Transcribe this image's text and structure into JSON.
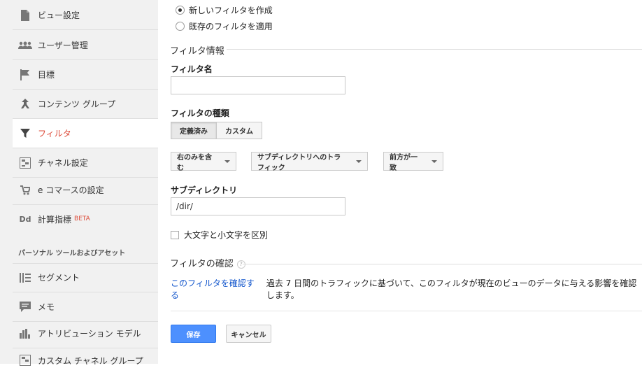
{
  "sidebar": {
    "items": [
      {
        "label": "ビュー設定",
        "icon": "document-icon"
      },
      {
        "label": "ユーザー管理",
        "icon": "users-icon"
      },
      {
        "label": "目標",
        "icon": "flag-icon"
      },
      {
        "label": "コンテンツ グループ",
        "icon": "content-group-icon"
      },
      {
        "label": "フィルタ",
        "icon": "filter-icon",
        "active": true
      },
      {
        "label": "チャネル設定",
        "icon": "channel-icon"
      },
      {
        "label": "e コマースの設定",
        "icon": "cart-icon"
      },
      {
        "label": "計算指標",
        "icon": "calculated-metrics-icon",
        "badge": "BETA",
        "icon_text": "Dd"
      }
    ],
    "section_title": "パーソナル ツールおよびアセット",
    "personal_items": [
      {
        "label": "セグメント",
        "icon": "segment-icon"
      },
      {
        "label": "メモ",
        "icon": "note-icon"
      },
      {
        "label": "アトリビューション モデル",
        "icon": "attribution-icon"
      },
      {
        "label": "カスタム チャネル グループ",
        "icon": "custom-channel-icon"
      }
    ]
  },
  "form": {
    "radio_new": "新しいフィルタを作成",
    "radio_existing": "既存のフィルタを適用",
    "filter_info_title": "フィルタ情報",
    "filter_name_label": "フィルタ名",
    "filter_name_value": "",
    "filter_type_label": "フィルタの種類",
    "type_predefined": "定義済み",
    "type_custom": "カスタム",
    "dropdown_include": "右のみを含む",
    "dropdown_traffic": "サブディレクトリへのトラフィック",
    "dropdown_match": "前方が一致",
    "subdirectory_label": "サブディレクトリ",
    "subdirectory_value": "/dir/",
    "case_sensitive_label": "大文字と小文字を区別",
    "verify_title": "フィルタの確認",
    "help_icon_text": "?",
    "verify_link": "このフィルタを確認する",
    "verify_desc": "過去 7 日間のトラフィックに基づいて、このフィルタが現在のビューのデータに与える影響を確認します。",
    "save_label": "保存",
    "cancel_label": "キャンセル"
  },
  "colors": {
    "active_red": "#dd4b39",
    "link_blue": "#1155cc",
    "save_blue": "#4d90fe"
  }
}
